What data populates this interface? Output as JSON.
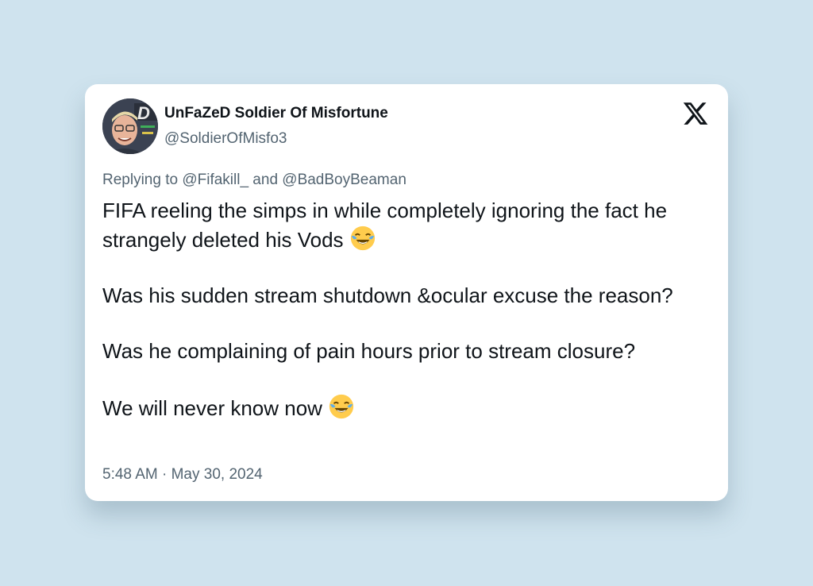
{
  "tweet": {
    "author": {
      "display_name": "UnFaZeD Soldier Of Misfortune",
      "handle": "@SoldierOfMisfo3"
    },
    "reply_context": "Replying to @Fifakill_ and @BadBoyBeaman",
    "paragraphs": [
      "FIFA reeling the simps in while completely ignoring the fact he strangely deleted his Vods",
      "Was his sudden stream shutdown &ocular excuse   the reason?",
      "Was he complaining of pain hours prior to stream closure?",
      "We will never know now"
    ],
    "timestamp": "5:48 AM · May 30, 2024"
  },
  "icons": {
    "platform_logo": "x-logo-icon",
    "emoji": "face-with-tears-of-joy-icon"
  },
  "colors": {
    "background": "#cfe3ee",
    "card": "#ffffff",
    "primary_text": "#0f1419",
    "secondary_text": "#536471"
  }
}
